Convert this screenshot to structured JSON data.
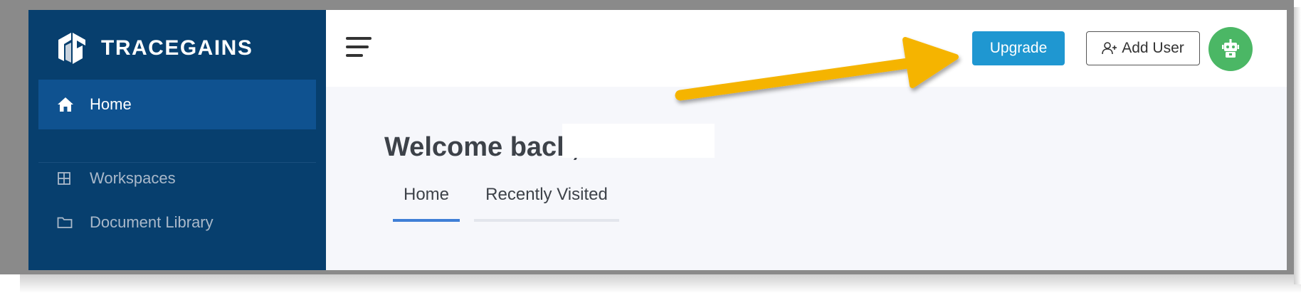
{
  "sidebar": {
    "brand": "TRACEGAINS",
    "items": [
      {
        "label": "Home",
        "icon": "home-icon"
      },
      {
        "label": "Workspaces",
        "icon": "grid-icon"
      },
      {
        "label": "Document Library",
        "icon": "folder-icon"
      }
    ]
  },
  "header": {
    "upgrade_label": "Upgrade",
    "add_user_label": "Add User",
    "avatar_icon": "robot-icon"
  },
  "main": {
    "welcome": "Welcome back,",
    "tabs": [
      {
        "label": "Home",
        "active": true
      },
      {
        "label": "Recently Visited",
        "active": false
      }
    ]
  },
  "colors": {
    "sidebar_bg": "#073f6e",
    "sidebar_active": "#0f5290",
    "upgrade_button": "#1f97d1",
    "avatar_bg": "#4bb765",
    "annotation_arrow": "#f5b400",
    "tab_active_underline": "#3f7fd6"
  }
}
